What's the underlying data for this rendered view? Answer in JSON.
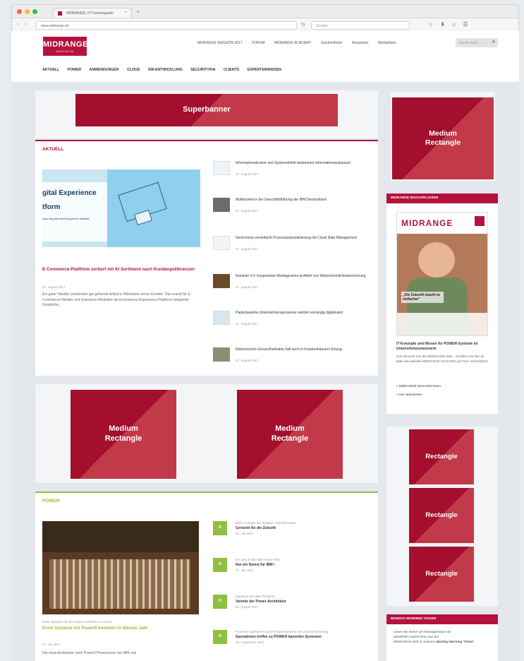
{
  "browser": {
    "tab_title": "MIDRANGE | IT-Fachmagazin",
    "tab_close": "×",
    "new_tab": "+",
    "url": "www.midrange.de",
    "search_placeholder": "Suchen",
    "back": "‹",
    "forward": "›",
    "reload": "↻",
    "icons": "☆ ⬇ ⌂ ☰"
  },
  "header": {
    "logo_text": "MIDRANGE",
    "logo_sub": "MAGAZIN",
    "top_nav": [
      "MIDRANGE MAGAZIN 2017",
      "FORUM",
      "MIDRANGE ACADEMY",
      "Solutionfinder",
      "Newsletter",
      "Mediadaten"
    ],
    "search_placeholder": "Suche nach ...",
    "main_nav": [
      "AKTUELL",
      "POWER",
      "ANWENDUNGEN",
      "CLOUD",
      "SW-ENTWICKLUNG",
      "SECURITY/HA",
      "CLIENTS",
      "EXPERTENWISSEN"
    ]
  },
  "ads": {
    "superbanner": "Superbanner",
    "medium_rectangle_line1": "Medium",
    "medium_rectangle_line2": "Rectangle",
    "rectangle": "Rectangle"
  },
  "aktuell": {
    "title": "AKTUELL",
    "hero_image_text_1": "gital Experience",
    "hero_image_text_2": "tform",
    "hero_image_caption": "ll your big data and best guest for websites",
    "lead_title": "E-Commerce-Plattform sortiert mit KI Sortiment nach Kundenpräferenzen",
    "lead_date": "27. August 2017",
    "lead_text": "Ein guter Händler positioniert gut gehende Artikel in Blickweite seiner Kunden. Das macht für E-Commerce-Händler und Enterprise-Websites die Ecommerce-Experience-Plattform integrierte Künstliche...",
    "items": [
      {
        "title": "Informationsdrucker und Systemdefekt bestimmen Informationsaustausch",
        "date": "27. August 2017"
      },
      {
        "title": "Mütterzirkel in der Geschäftsführung der IBM Deutschland",
        "date": "27. August 2017"
      },
      {
        "title": "Servicenow vereinfacht Prozessautomatisierung mit Cloud Data Management",
        "date": "27. August 2017"
      },
      {
        "title": "Industrie 4.0: Kooperative Montagearme profitiert von Wahrscheinlichkeitsrechnung",
        "date": "27. August 2017"
      },
      {
        "title": "Papierbasierte Unternehmensprozesse werden vorrangig digitalisiert",
        "date": "27. August 2017"
      },
      {
        "title": "Elektronische Gesundheitsakte hält auch in Krankenhäusern Einzug",
        "date": "27. August 2017"
      }
    ]
  },
  "power": {
    "title": "POWER",
    "lead_kicker": "Erste Systeme mit der neuen Architektur in Kürze",
    "lead_title": "Erste Systeme mit Power9 kommen in diesem Jahr",
    "lead_date": "17. Juli 2017",
    "lead_text": "Die neue Architektur nach Power9 Prozessoren bei IBM und",
    "items": [
      {
        "kicker": "IBM i in Zeiten der digitalen Transformation",
        "title": "Gerüstet für die Zukunft",
        "date": "24. Juli 2017"
      },
      {
        "kicker": "Ein Jahr in der IBM Power-Welt",
        "title": "Nur ein Dienst für IBM i",
        "date": "17. Juli 2017"
      },
      {
        "kicker": "Migration auf IBM POWER8",
        "title": "Vorteile der Power-Architektur",
        "date": "21. August 2017"
      },
      {
        "kicker": "Prozesse optimieren durch Power-Systeme mit Linux-Erweiterung",
        "title": "Spezialisten treffen zu POWER-basierten Systemen",
        "date": "25. September 2017"
      }
    ]
  },
  "sidebar": {
    "mag_head": "MIDRANGE MAGAZIN LESEN",
    "cover_logo": "MIDRANGE",
    "cover_quote": "„Die Zukunft macht es einfacher“",
    "mag_title": "IT-Konzepte und Wissen für POWER-Systeme im Unternehmensnetzwerk",
    "mag_text": "Das Neueste aus der MIDRANGE Welt – erhalten Sie hier ab Mitte das aktuelle MIDRANGE MAGAZIN auf Ihren Schreibtisch.",
    "mag_link1": "» MIDRANGE MAGAZIN lesen",
    "mag_link2": "» Hier abonnieren",
    "ticker_head": "MONDAY MORNING TICKER",
    "ticker_text_1": "Lesen Sie immer am Montagmorgen die",
    "ticker_text_2": "aktuellsten Nachrichten aus der",
    "ticker_text_3": "MIDRANGE-Welt in unserem",
    "ticker_bold": "Monday Morning Ticker!"
  },
  "colors": {
    "brand_red": "#b5123b",
    "ad_dark": "#a30f2d",
    "ad_light": "#c23a49",
    "power_green": "#8fbf3f"
  }
}
